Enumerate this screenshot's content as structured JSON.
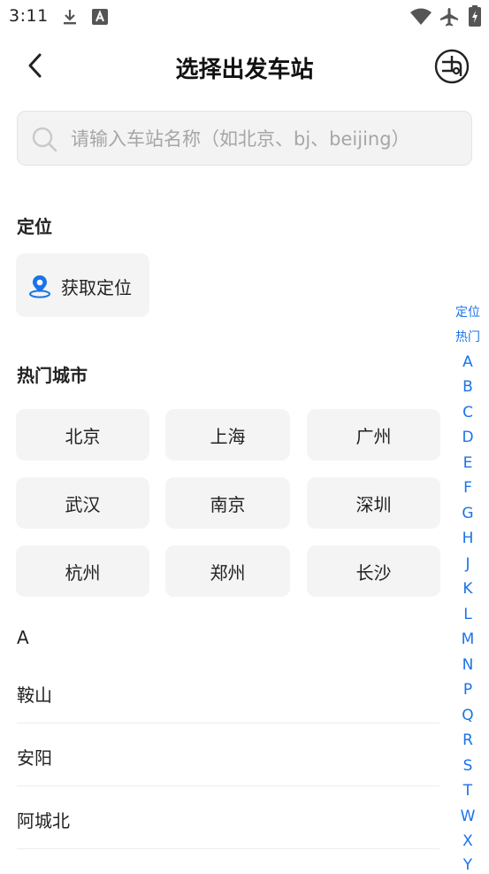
{
  "status_bar": {
    "time": "3:11",
    "left_icons": [
      "download-icon",
      "a-notification-icon"
    ],
    "right_icons": [
      "wifi-icon",
      "airplane-icon",
      "battery-charging-icon"
    ]
  },
  "header": {
    "title": "选择出发车站",
    "back_icon": "chevron-left-icon",
    "map_icon": "route-map-icon"
  },
  "search": {
    "placeholder": "请输入车站名称（如北京、bj、beijing）",
    "value": ""
  },
  "location": {
    "section_title": "定位",
    "button_label": "获取定位"
  },
  "hot_cities": {
    "section_title": "热门城市",
    "items": [
      "北京",
      "上海",
      "广州",
      "武汉",
      "南京",
      "深圳",
      "杭州",
      "郑州",
      "长沙"
    ]
  },
  "station_list": {
    "letter": "A",
    "items": [
      "鞍山",
      "安阳",
      "阿城北"
    ]
  },
  "index_bar": {
    "items": [
      "定位",
      "热门",
      "A",
      "B",
      "C",
      "D",
      "E",
      "F",
      "G",
      "H",
      "J",
      "K",
      "L",
      "M",
      "N",
      "P",
      "Q",
      "R",
      "S",
      "T",
      "W",
      "X",
      "Y"
    ]
  },
  "colors": {
    "accent": "#1a73e8",
    "button_bg": "#f4f4f4",
    "text": "#222222",
    "placeholder": "#a6a6a6"
  }
}
